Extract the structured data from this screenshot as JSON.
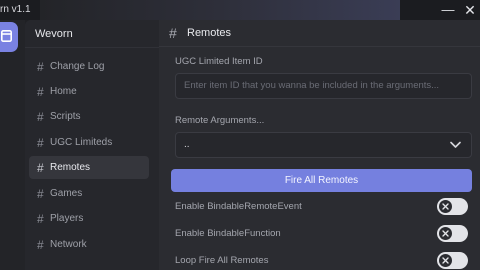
{
  "window": {
    "title": "rn v1.1",
    "minimize_glyph": "—",
    "close_glyph": "✕"
  },
  "brand": "Wevorn",
  "sidebar": {
    "items": [
      {
        "label": "Change Log",
        "active": false
      },
      {
        "label": "Home",
        "active": false
      },
      {
        "label": "Scripts",
        "active": false
      },
      {
        "label": "UGC Limiteds",
        "active": false
      },
      {
        "label": "Remotes",
        "active": true
      },
      {
        "label": "Games",
        "active": false
      },
      {
        "label": "Players",
        "active": false
      },
      {
        "label": "Network",
        "active": false
      }
    ]
  },
  "hash_glyph": "#",
  "content": {
    "title": "Remotes",
    "ugc_label": "UGC Limited Item ID",
    "ugc_placeholder": "Enter item ID that you wanna be included in the arguments...",
    "args_label": "Remote Arguments...",
    "args_value": "..",
    "fire_button": "Fire All Remotes",
    "toggles": [
      {
        "label": "Enable BindableRemoteEvent",
        "on": false
      },
      {
        "label": "Enable BindableFunction",
        "on": false
      },
      {
        "label": "Loop Fire All Remotes",
        "on": false
      }
    ]
  },
  "colors": {
    "accent": "#7580df",
    "background": "#2b2c31",
    "sidebar": "#26272c"
  },
  "icons": {
    "app": "window-icon",
    "select_arrow": "chevron-down-icon",
    "toggle_off": "x-icon"
  }
}
